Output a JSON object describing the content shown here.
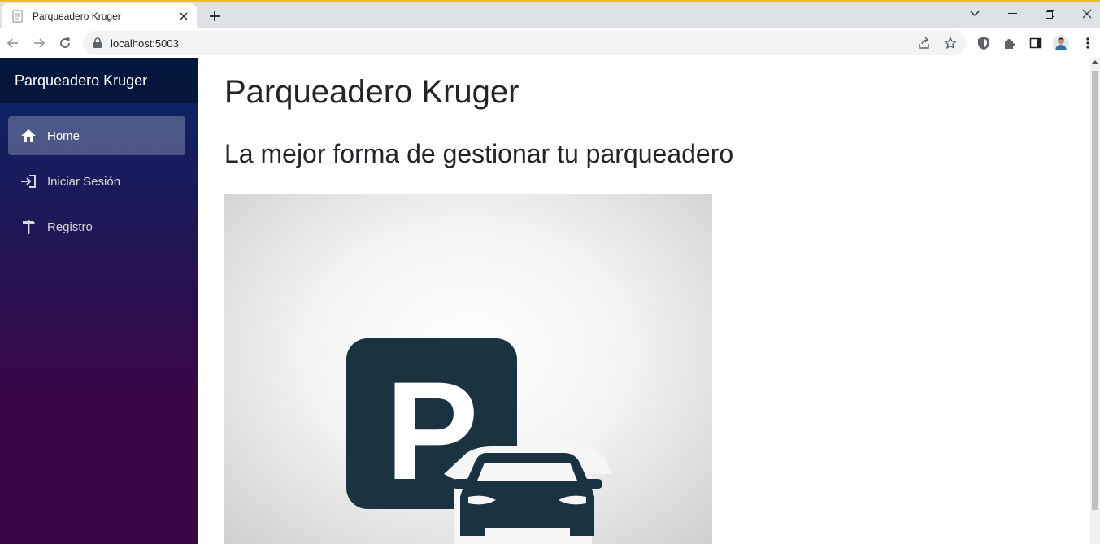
{
  "browser": {
    "tab_title": "Parqueadero Kruger",
    "url": "localhost:5003"
  },
  "sidebar": {
    "brand": "Parqueadero Kruger",
    "items": [
      {
        "label": "Home",
        "icon": "home-icon",
        "active": true
      },
      {
        "label": "Iniciar Sesión",
        "icon": "sign-in-icon",
        "active": false
      },
      {
        "label": "Registro",
        "icon": "signpost-icon",
        "active": false
      }
    ]
  },
  "main": {
    "title": "Parqueadero Kruger",
    "subtitle": "La mejor forma de gestionar tu parqueadero",
    "hero_image": "parking-car-icon",
    "hero_letter": "P"
  },
  "colors": {
    "sidebar_top": "#052767",
    "sidebar_bottom": "#3a0647",
    "icon_dark": "#1b3340"
  }
}
